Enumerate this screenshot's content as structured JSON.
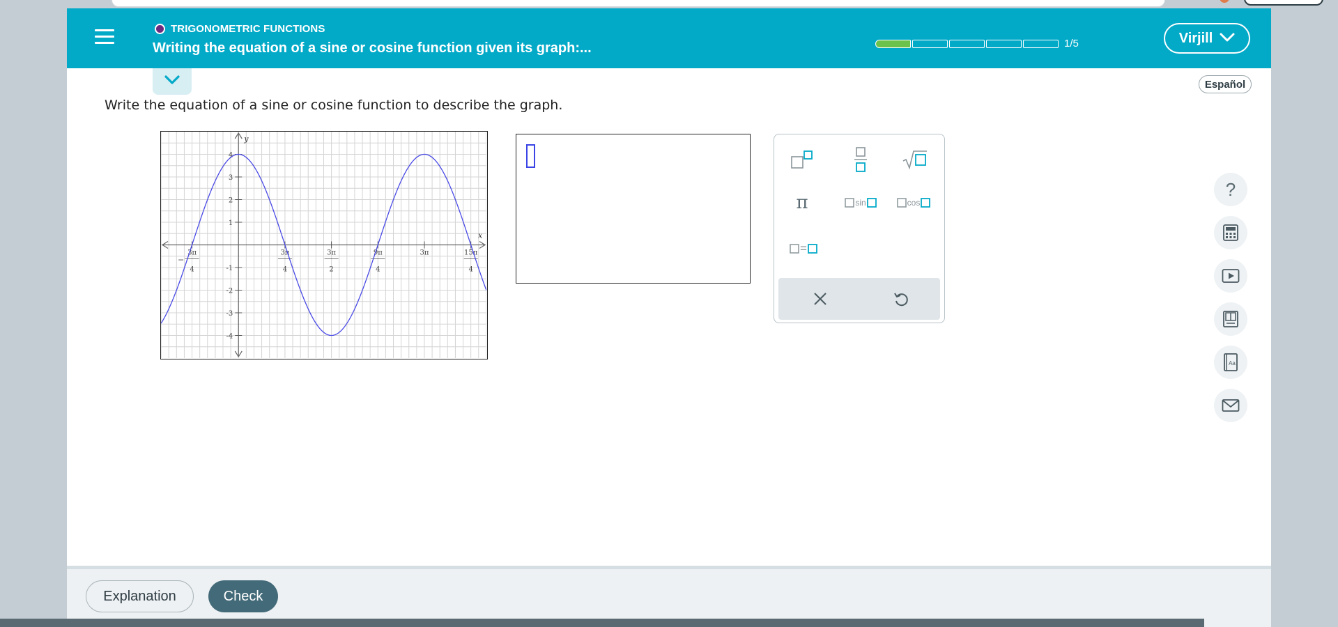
{
  "header": {
    "topic": "TRIGONOMETRIC FUNCTIONS",
    "title": "Writing the equation of a sine or cosine function given its graph:...",
    "progress_label": "1/5",
    "progress_fraction": 0.2,
    "user_name": "Virjill",
    "menu_icon": "hamburger-icon"
  },
  "language_button": "Español",
  "question": {
    "prompt": "Write the equation of a sine or cosine function to describe the graph."
  },
  "graph": {
    "x_axis_label": "x",
    "y_axis_label": "y",
    "y_ticks": [
      {
        "value": 4,
        "label": "4"
      },
      {
        "value": 3,
        "label": "3"
      },
      {
        "value": 2,
        "label": "2"
      },
      {
        "value": 1,
        "label": "1"
      },
      {
        "value": -1,
        "label": "-1"
      },
      {
        "value": -2,
        "label": "-2"
      },
      {
        "value": -3,
        "label": "-3"
      },
      {
        "value": -4,
        "label": "-4"
      }
    ],
    "x_ticks": [
      {
        "value": -2.356,
        "num": "3π",
        "den": "4",
        "neg": true
      },
      {
        "value": 2.356,
        "num": "3π",
        "den": "4",
        "neg": false
      },
      {
        "value": 4.712,
        "num": "3π",
        "den": "2",
        "neg": false
      },
      {
        "value": 7.069,
        "num": "9π",
        "den": "4",
        "neg": false
      },
      {
        "value": 9.425,
        "num": "3π",
        "den": "",
        "neg": false
      },
      {
        "value": 11.781,
        "num": "15π",
        "den": "4",
        "neg": false
      }
    ],
    "curve": {
      "amplitude": 4,
      "peak_x": 0,
      "period_x": 9.425,
      "x_min": -3.93,
      "x_max": 12.57,
      "y_min": -5,
      "y_max": 5,
      "color": "#4a4ae6"
    }
  },
  "palette": {
    "buttons": [
      "superscript-icon",
      "fraction-icon",
      "sqrt-icon",
      "pi-icon",
      "sin-icon",
      "cos-icon",
      "equals-icon"
    ],
    "pi": "π",
    "sin": "sin",
    "cos": "cos",
    "equals": "=",
    "actions": [
      "clear-icon",
      "undo-icon"
    ]
  },
  "side_tools": [
    "help-icon",
    "calculator-icon",
    "video-icon",
    "ebook-icon",
    "dictionary-icon",
    "message-icon"
  ],
  "footer": {
    "explanation": "Explanation",
    "check": "Check"
  },
  "colors": {
    "brand": "#03aac8",
    "progress_done": "#6cc24a",
    "check_button": "#436a78",
    "accent_square": "#03aac8"
  }
}
